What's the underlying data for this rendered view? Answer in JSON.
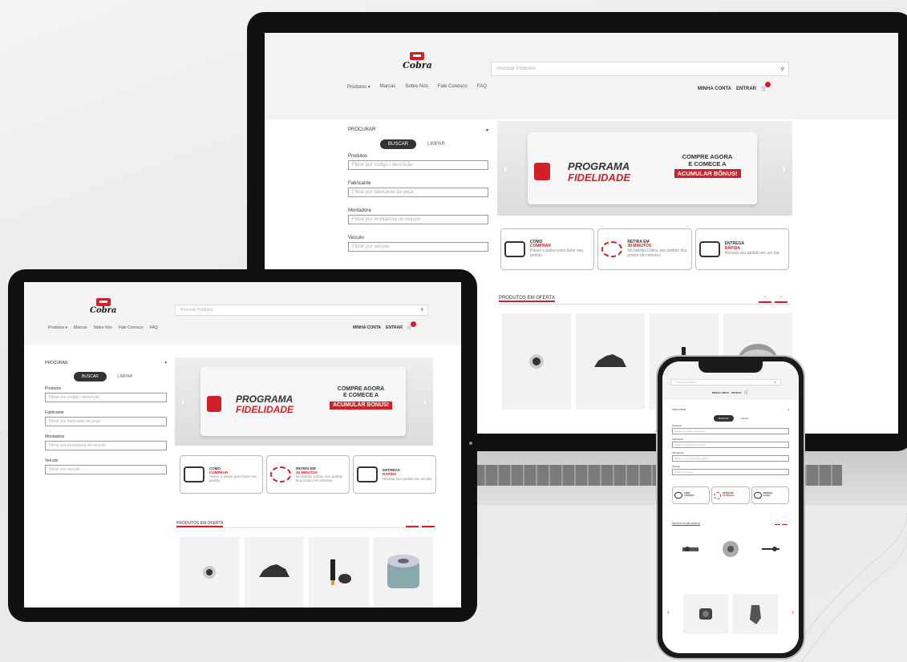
{
  "brand": {
    "name": "Cobra",
    "accent": "#d32027",
    "dark": "#333333"
  },
  "site": {
    "search_placeholder": "Procurar Produtos",
    "nav": [
      "Produtos ▾",
      "Marcas",
      "Sobre Nós",
      "Fale Conosco",
      "FAQ"
    ],
    "account": {
      "login": "MINHA CONTA",
      "signup": "ENTRAR"
    },
    "sidebar": {
      "title": "PROCURAR",
      "search_button": "BUSCAR",
      "clear_button": "LIMPAR",
      "fields": [
        {
          "label": "Produtos",
          "placeholder": "Filtrar por código / descrição"
        },
        {
          "label": "Fabricante",
          "placeholder": "Filtrar por fabricante da peça"
        },
        {
          "label": "Montadora",
          "placeholder": "Filtrar por montadora do veículo"
        },
        {
          "label": "Veículo",
          "placeholder": "Filtrar por veículo"
        }
      ]
    },
    "banner": {
      "program_line1": "PROGRAMA",
      "program_line2": "FIDELIDADE",
      "cta_line1": "COMPRE AGORA",
      "cta_line2": "E COMECE A",
      "cta_highlight": "ACUMULAR BÔNUS!"
    },
    "features": [
      {
        "a": "COMO",
        "b": "COMPRAR",
        "c": "Passo a passo para fazer seu pedido"
      },
      {
        "a": "RETIRA EM",
        "b": "30 MINUTOS",
        "c": "No balcão Cobra, seu pedido fica pronto em minutos"
      },
      {
        "a": "ENTREGA",
        "b": "RÁPIDA",
        "c": "Receba seu pedido em um dia"
      }
    ],
    "offers_title": "PRODUTOS EM OFERTA",
    "pager": [
      "‹",
      "›"
    ]
  },
  "icons": {
    "search": "search-icon",
    "cart": "cart-icon",
    "chevron": "chevron-down-icon",
    "arrow_left": "arrow-left-icon",
    "arrow_right": "arrow-right-icon"
  }
}
